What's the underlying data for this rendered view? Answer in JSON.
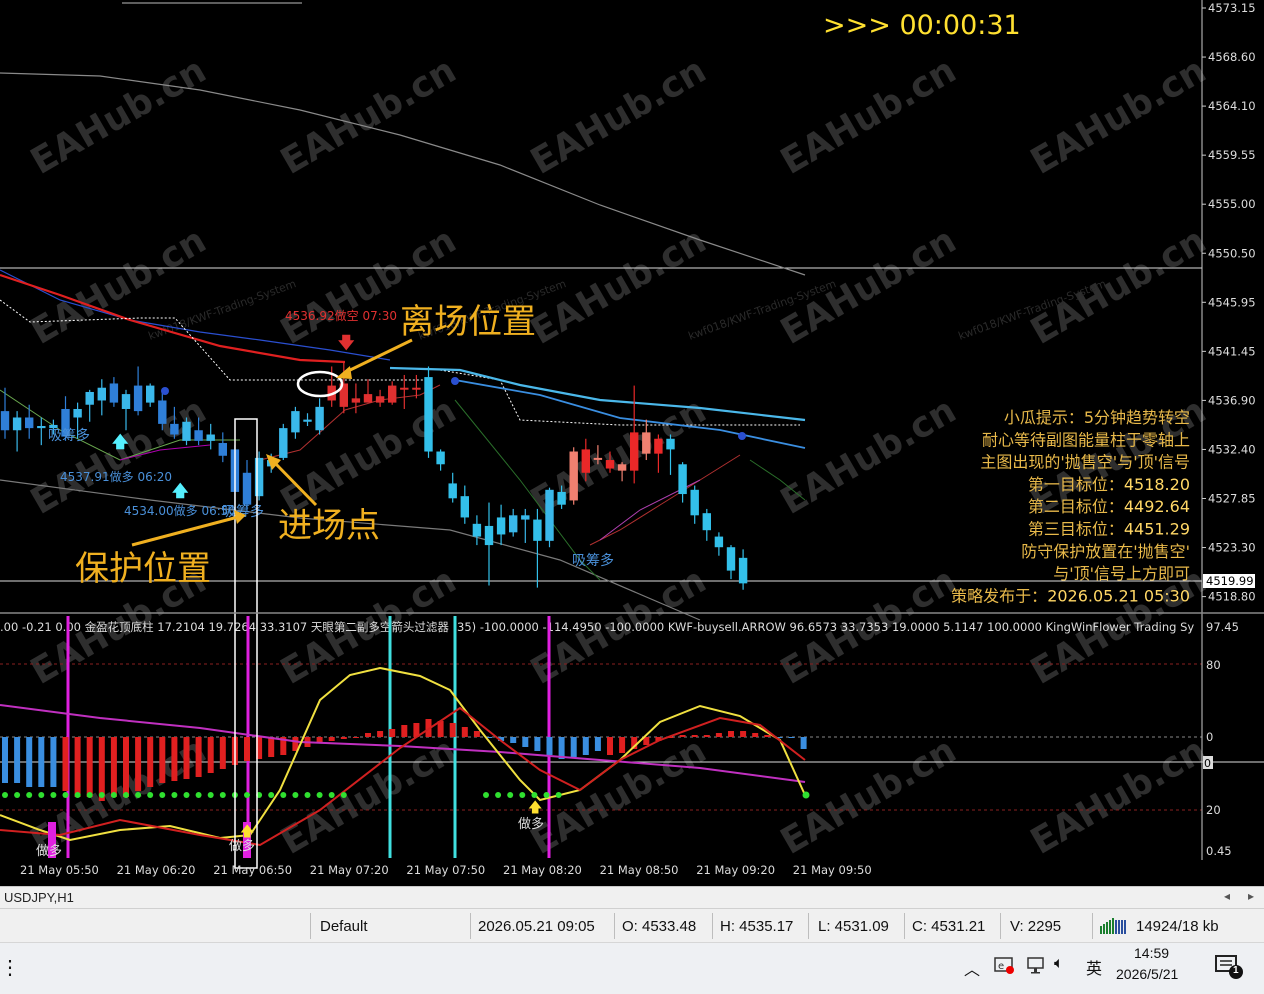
{
  "chart_data": [
    {
      "type": "candlestick",
      "symbol": "USDJPY,H1",
      "y_ticks": [
        "4573.15",
        "4568.60",
        "4564.10",
        "4559.55",
        "4555.00",
        "4550.50",
        "4545.95",
        "4541.45",
        "4536.90",
        "4532.40",
        "4527.85",
        "4523.30",
        "4518.80"
      ],
      "current_price_label": "4519.99",
      "x_ticks": [
        "21 May 05:50",
        "21 May 06:20",
        "21 May 06:50",
        "21 May 07:20",
        "21 May 07:50",
        "21 May 08:20",
        "21 May 08:50",
        "21 May 09:20",
        "21 May 09:50"
      ],
      "candles": [
        {
          "o": 4535.2,
          "h": 4537.4,
          "l": 4532.6,
          "c": 4533.4,
          "dir": "down"
        },
        {
          "o": 4533.4,
          "h": 4535.2,
          "l": 4531.4,
          "c": 4534.6,
          "dir": "up"
        },
        {
          "o": 4534.6,
          "h": 4535.8,
          "l": 4532.6,
          "c": 4533.6,
          "dir": "down"
        },
        {
          "o": 4533.6,
          "h": 4534.6,
          "l": 4532.0,
          "c": 4533.8,
          "dir": "up"
        },
        {
          "o": 4533.6,
          "h": 4534.4,
          "l": 4533.0,
          "c": 4533.9,
          "dir": "up"
        },
        {
          "o": 4535.4,
          "h": 4536.6,
          "l": 4532.4,
          "c": 4532.8,
          "dir": "down"
        },
        {
          "o": 4534.6,
          "h": 4536.0,
          "l": 4532.6,
          "c": 4535.4,
          "dir": "up"
        },
        {
          "o": 4535.8,
          "h": 4537.2,
          "l": 4534.2,
          "c": 4537.0,
          "dir": "up"
        },
        {
          "o": 4536.2,
          "h": 4538.2,
          "l": 4534.8,
          "c": 4537.4,
          "dir": "up"
        },
        {
          "o": 4537.8,
          "h": 4538.4,
          "l": 4535.6,
          "c": 4536.0,
          "dir": "down"
        },
        {
          "o": 4535.4,
          "h": 4537.2,
          "l": 4533.4,
          "c": 4536.8,
          "dir": "up"
        },
        {
          "o": 4537.6,
          "h": 4539.4,
          "l": 4534.8,
          "c": 4535.2,
          "dir": "down"
        },
        {
          "o": 4537.6,
          "h": 4537.8,
          "l": 4535.6,
          "c": 4536.0,
          "dir": "up"
        },
        {
          "o": 4536.2,
          "h": 4537.2,
          "l": 4533.4,
          "c": 4534.0,
          "dir": "down"
        },
        {
          "o": 4534.0,
          "h": 4535.6,
          "l": 4532.6,
          "c": 4533.0,
          "dir": "down"
        },
        {
          "o": 4532.4,
          "h": 4534.6,
          "l": 4532.0,
          "c": 4534.2,
          "dir": "up"
        },
        {
          "o": 4533.4,
          "h": 4534.6,
          "l": 4532.0,
          "c": 4532.4,
          "dir": "down"
        },
        {
          "o": 4533.0,
          "h": 4534.0,
          "l": 4531.6,
          "c": 4532.4,
          "dir": "up"
        },
        {
          "o": 4532.2,
          "h": 4533.2,
          "l": 4530.4,
          "c": 4531.0,
          "dir": "down"
        },
        {
          "o": 4531.6,
          "h": 4532.0,
          "l": 4526.4,
          "c": 4527.6,
          "dir": "down"
        },
        {
          "o": 4529.4,
          "h": 4530.6,
          "l": 4525.8,
          "c": 4526.4,
          "dir": "down"
        },
        {
          "o": 4527.2,
          "h": 4531.4,
          "l": 4526.8,
          "c": 4530.8,
          "dir": "up"
        },
        {
          "o": 4530.6,
          "h": 4531.2,
          "l": 4529.4,
          "c": 4530.0,
          "dir": "up"
        },
        {
          "o": 4530.8,
          "h": 4534.0,
          "l": 4530.6,
          "c": 4533.6,
          "dir": "up"
        },
        {
          "o": 4533.2,
          "h": 4535.6,
          "l": 4532.6,
          "c": 4535.2,
          "dir": "up"
        },
        {
          "o": 4534.2,
          "h": 4535.0,
          "l": 4533.8,
          "c": 4534.4,
          "dir": "up"
        },
        {
          "o": 4533.4,
          "h": 4536.4,
          "l": 4533.0,
          "c": 4535.6,
          "dir": "up"
        },
        {
          "o": 4537.6,
          "h": 4539.4,
          "l": 4535.6,
          "c": 4536.2,
          "dir": "down"
        },
        {
          "o": 4537.8,
          "h": 4539.8,
          "l": 4535.0,
          "c": 4535.6,
          "dir": "down"
        },
        {
          "o": 4536.4,
          "h": 4537.8,
          "l": 4535.0,
          "c": 4536.0,
          "dir": "down"
        },
        {
          "o": 4536.8,
          "h": 4538.2,
          "l": 4536.0,
          "c": 4536.0,
          "dir": "down"
        },
        {
          "o": 4536.0,
          "h": 4537.2,
          "l": 4535.6,
          "c": 4536.6,
          "dir": "down"
        },
        {
          "o": 4537.6,
          "h": 4538.0,
          "l": 4535.8,
          "c": 4536.0,
          "dir": "down"
        },
        {
          "o": 4537.4,
          "h": 4538.6,
          "l": 4535.4,
          "c": 4537.4,
          "dir": "down"
        },
        {
          "o": 4537.4,
          "h": 4538.6,
          "l": 4536.4,
          "c": 4537.4,
          "dir": "down"
        },
        {
          "o": 4538.4,
          "h": 4539.4,
          "l": 4530.8,
          "c": 4531.4,
          "dir": "down"
        },
        {
          "o": 4531.4,
          "h": 4531.6,
          "l": 4529.6,
          "c": 4530.2,
          "dir": "down"
        },
        {
          "o": 4528.4,
          "h": 4529.4,
          "l": 4526.6,
          "c": 4527.0,
          "dir": "down"
        },
        {
          "o": 4527.2,
          "h": 4528.2,
          "l": 4524.6,
          "c": 4525.2,
          "dir": "down"
        },
        {
          "o": 4524.6,
          "h": 4525.4,
          "l": 4522.6,
          "c": 4523.4,
          "dir": "down"
        },
        {
          "o": 4524.4,
          "h": 4526.6,
          "l": 4518.8,
          "c": 4522.6,
          "dir": "down"
        },
        {
          "o": 4525.2,
          "h": 4526.4,
          "l": 4522.6,
          "c": 4523.6,
          "dir": "down"
        },
        {
          "o": 4523.8,
          "h": 4526.0,
          "l": 4523.4,
          "c": 4525.4,
          "dir": "up"
        },
        {
          "o": 4525.0,
          "h": 4526.0,
          "l": 4522.8,
          "c": 4525.4,
          "dir": "up"
        },
        {
          "o": 4525.0,
          "h": 4526.0,
          "l": 4518.6,
          "c": 4523.0,
          "dir": "down"
        },
        {
          "o": 4523.0,
          "h": 4528.0,
          "l": 4522.4,
          "c": 4527.8,
          "dir": "up"
        },
        {
          "o": 4527.6,
          "h": 4528.2,
          "l": 4526.0,
          "c": 4526.4,
          "dir": "down"
        },
        {
          "o": 4526.8,
          "h": 4531.8,
          "l": 4526.4,
          "c": 4531.4,
          "dir": "up"
        },
        {
          "o": 4531.6,
          "h": 4532.6,
          "l": 4528.6,
          "c": 4529.4,
          "dir": "down"
        },
        {
          "o": 4530.8,
          "h": 4532.0,
          "l": 4530.2,
          "c": 4530.8,
          "dir": "down"
        },
        {
          "o": 4530.6,
          "h": 4531.4,
          "l": 4529.4,
          "c": 4529.8,
          "dir": "down"
        },
        {
          "o": 4529.6,
          "h": 4530.4,
          "l": 4528.6,
          "c": 4530.2,
          "dir": "down"
        },
        {
          "o": 4529.6,
          "h": 4537.6,
          "l": 4528.4,
          "c": 4533.2,
          "dir": "down"
        },
        {
          "o": 4533.2,
          "h": 4534.4,
          "l": 4530.6,
          "c": 4531.2,
          "dir": "down"
        },
        {
          "o": 4531.2,
          "h": 4533.0,
          "l": 4529.4,
          "c": 4532.6,
          "dir": "down"
        },
        {
          "o": 4532.6,
          "h": 4533.0,
          "l": 4529.2,
          "c": 4531.6,
          "dir": "down"
        },
        {
          "o": 4530.2,
          "h": 4530.4,
          "l": 4526.6,
          "c": 4527.4,
          "dir": "down"
        },
        {
          "o": 4527.8,
          "h": 4528.2,
          "l": 4524.6,
          "c": 4525.4,
          "dir": "down"
        },
        {
          "o": 4525.6,
          "h": 4526.0,
          "l": 4523.0,
          "c": 4524.0,
          "dir": "down"
        },
        {
          "o": 4523.4,
          "h": 4523.8,
          "l": 4521.6,
          "c": 4522.4,
          "dir": "down"
        },
        {
          "o": 4522.4,
          "h": 4522.6,
          "l": 4519.4,
          "c": 4520.2,
          "dir": "down"
        },
        {
          "o": 4521.4,
          "h": 4522.2,
          "l": 4518.4,
          "c": 4519.0,
          "dir": "down"
        }
      ],
      "price_annotations": [
        {
          "text": "4536.92做空 07:30",
          "color": "#e03030"
        },
        {
          "text": "4537.91做多 06:20",
          "color": "#4a90d9"
        },
        {
          "text": "4534.00做多 06:50",
          "color": "#4a90d9"
        }
      ],
      "signal_labels": [
        "吸筹多",
        "吸筹多",
        "吸筹多"
      ],
      "callouts": {
        "exit": "离场位置",
        "entry": "进场点",
        "stop": "保护位置"
      },
      "timer": ">>> 00:00:31",
      "info_lines": [
        {
          "text": "小瓜提示：5分钟趋势转空",
          "value": ""
        },
        {
          "text": "耐心等待副图能量柱于零轴上",
          "value": ""
        },
        {
          "text": "主图出现的'抛售空'与'顶'信号",
          "value": ""
        },
        {
          "text": "第一目标位：",
          "value": "4518.20"
        },
        {
          "text": "第二目标位：",
          "value": "4492.64"
        },
        {
          "text": "第三目标位：",
          "value": "4451.29"
        },
        {
          "text": "防守保护放置在'抛售空'",
          "value": ""
        },
        {
          "text": "与'顶'信号上方即可",
          "value": ""
        },
        {
          "text": "策略发布于：",
          "value": "2026.05.21 05:30"
        }
      ],
      "watermark": "EAHub.cn",
      "subwatermark": "kwf018/KWF-Trading-System"
    },
    {
      "type": "histogram",
      "header": ".00 -0.21 0.00   金盈花顶底柱 17.2104 19.7264 33.3107   天眼第二副多空箭头过滤器 (35) -100.0000 -114.4950 -100.0000   KWF-buysell.ARROW 96.6573 33.7353 19.0000 5.1147 100.0000   KingWinFlower Trading Sy",
      "y_ticks": [
        "97.45",
        "80",
        "0",
        "20",
        "0.45"
      ],
      "zero_label": "0",
      "values": [
        -23,
        -23,
        -25,
        -25,
        -25,
        -27,
        -30,
        -30,
        -32,
        -30,
        -30,
        -27,
        -25,
        -23,
        -22,
        -21,
        -20,
        -18,
        -16,
        -14,
        -12,
        -11,
        -10,
        -9,
        -7,
        -5,
        -3,
        -2,
        -1,
        0,
        2,
        3,
        4,
        6,
        7,
        9,
        8,
        7,
        5,
        3,
        0,
        -2,
        -3,
        -5,
        -7,
        -9,
        -11,
        -10,
        -9,
        -7,
        -9,
        -8,
        -6,
        -4,
        -2,
        0,
        1,
        1,
        1,
        2,
        3,
        3,
        2,
        1,
        0,
        0,
        -6
      ],
      "signal_labels": [
        "做多",
        "做多",
        "做多"
      ]
    }
  ],
  "tab": {
    "label": "USDJPY,H1"
  },
  "status": {
    "profile": "Default",
    "datetime": "2026.05.21 09:05",
    "open": "O: 4533.48",
    "high": "H: 4535.17",
    "low": "L: 4531.09",
    "close": "C: 4531.21",
    "volume": "V: 2295",
    "traffic": "14924/18 kb"
  },
  "taskbar": {
    "time": "14:59",
    "date": "2026/5/21",
    "ime": "英",
    "notif_count": "1"
  }
}
